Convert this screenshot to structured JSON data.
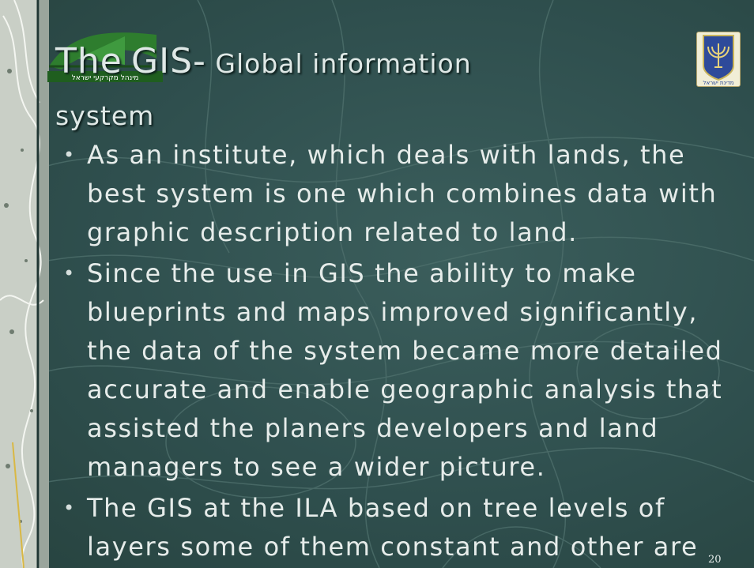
{
  "title": {
    "prefix": "The",
    "main": "GIS-",
    "rest": " Global information",
    "line2": "system"
  },
  "bullets": [
    "As an institute, which deals with lands, the best system is one which combines data with graphic description related to land.",
    "Since the use in GIS the ability to make blueprints and maps improved significantly, the data of the system became more detailed accurate and enable geographic analysis that assisted the planers developers and land managers to see a wider picture.",
    "The GIS at the ILA based on tree levels of layers some of them constant and other are"
  ],
  "page_number": "20",
  "logo_left_caption": "מינהל מקרקעי ישראל",
  "emblem_caption": "מדינת ישראל",
  "colors": {
    "background": "#2f4f4e",
    "text": "#e6ecea",
    "logo_green": "#2e7d2e"
  }
}
